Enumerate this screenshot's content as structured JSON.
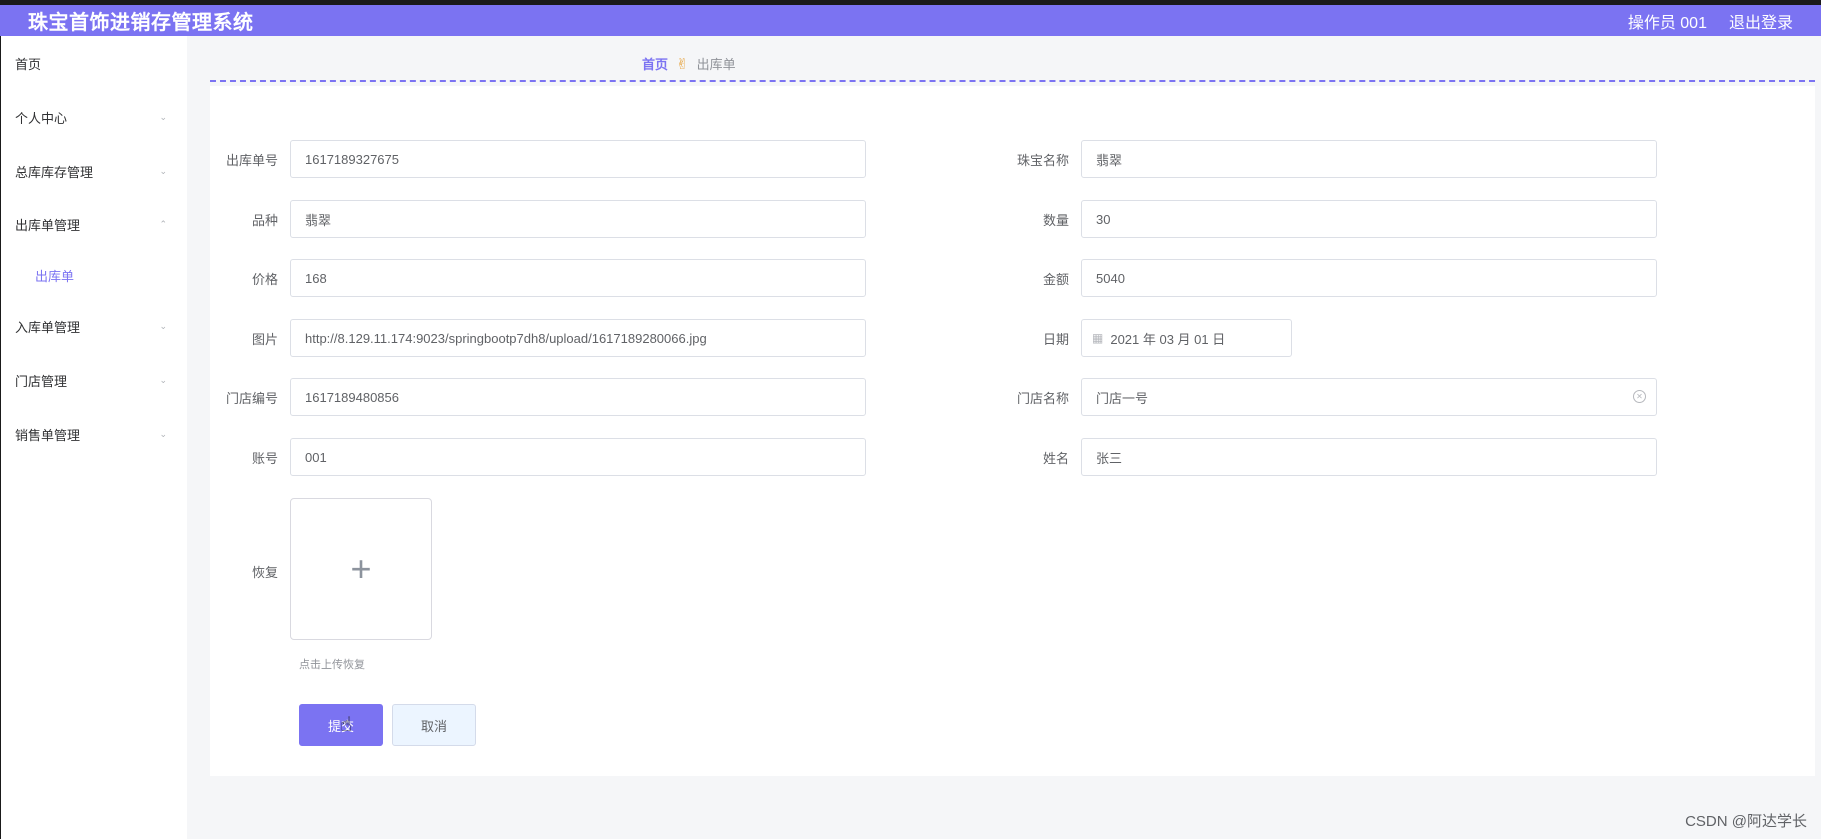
{
  "header": {
    "title": "珠宝首饰进销存管理系统",
    "operator": "操作员 001",
    "logout": "退出登录"
  },
  "sidebar": {
    "items": [
      {
        "label": "首页"
      },
      {
        "label": "个人中心"
      },
      {
        "label": "总库库存管理"
      },
      {
        "label": "出库单管理"
      },
      {
        "label": "入库单管理"
      },
      {
        "label": "门店管理"
      },
      {
        "label": "销售单管理"
      }
    ],
    "sub_item": "出库单"
  },
  "breadcrumb": {
    "home": "首页",
    "separator_icon": "hand-ok-icon",
    "current": "出库单"
  },
  "form": {
    "order_no": {
      "label": "出库单号",
      "value": "1617189327675"
    },
    "jewel_name": {
      "label": "珠宝名称",
      "value": "翡翠"
    },
    "variety": {
      "label": "品种",
      "value": "翡翠"
    },
    "quantity": {
      "label": "数量",
      "value": "30"
    },
    "price": {
      "label": "价格",
      "value": "168"
    },
    "amount": {
      "label": "金额",
      "value": "5040"
    },
    "image": {
      "label": "图片",
      "value": "http://8.129.11.174:9023/springbootp7dh8/upload/1617189280066.jpg"
    },
    "date": {
      "label": "日期",
      "value": "2021 年 03 月 01 日"
    },
    "store_no": {
      "label": "门店编号",
      "value": "1617189480856"
    },
    "store_name": {
      "label": "门店名称",
      "value": "门店一号"
    },
    "account": {
      "label": "账号",
      "value": "001"
    },
    "name": {
      "label": "姓名",
      "value": "张三"
    },
    "restore": {
      "label": "恢复",
      "tip": "点击上传恢复"
    }
  },
  "buttons": {
    "submit": "提交",
    "cancel": "取消"
  },
  "watermark": "CSDN @阿达学长",
  "colors": {
    "accent": "#7b73f2",
    "cancel_bg": "#ecf5ff"
  }
}
